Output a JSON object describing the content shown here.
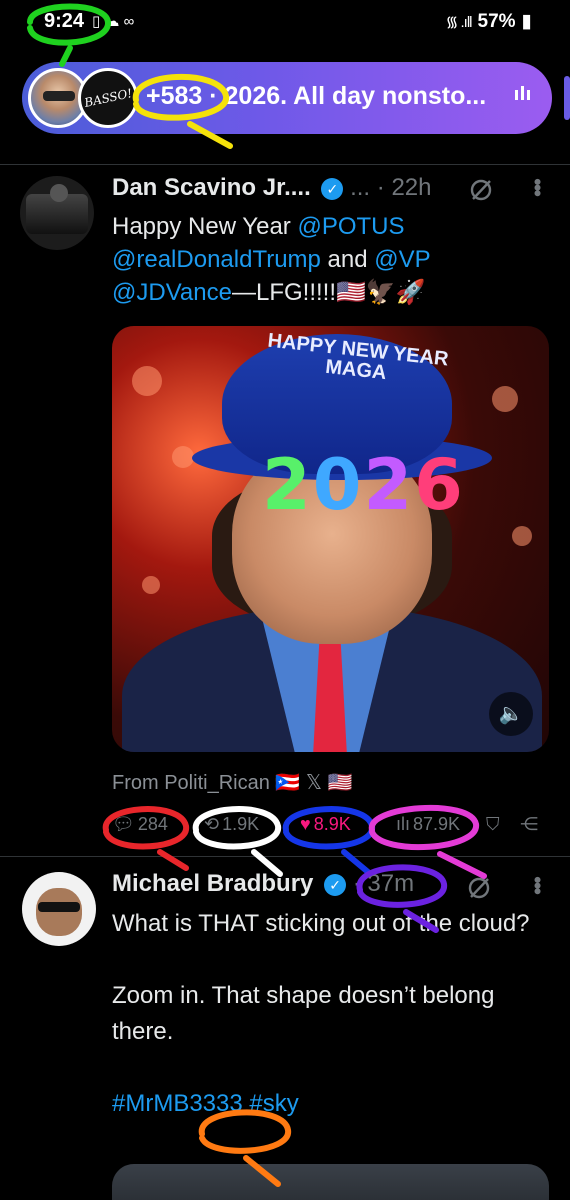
{
  "status_bar": {
    "time": "9:24",
    "left_icons": "▯ ☁ ∞",
    "battery": "57%",
    "signal_icon": "wifi-signal-icon"
  },
  "live_space": {
    "pill_text": "+583 · 2026. All day nonsto...",
    "avatar2_text": "BASSO!"
  },
  "tweet1": {
    "name": "Dan Scavino Jr....",
    "meta_dots": "...",
    "time": "· 22h",
    "body": {
      "text1": "Happy New Year ",
      "mention1": "@POTUS",
      "mention2": "@realDonaldTrump",
      "text2": " and ",
      "mention3": "@VP",
      "mention4": "@JDVance",
      "text3": "—LFG!!!!!🇺🇸🦅🚀"
    },
    "media": {
      "hat_text": "HAPPY NEW YEAR MAGA",
      "glasses_digits": [
        "2",
        "0",
        "2",
        "6"
      ]
    },
    "from": "From Politi_Rican 🇵🇷 𝕏 🇺🇸",
    "actions": {
      "replies": "284",
      "reposts": "1.9K",
      "likes": "8.9K",
      "views": "87.9K"
    }
  },
  "tweet2": {
    "name": "Michael Bradbury",
    "time": "· 37m",
    "body": {
      "line1": "What is THAT sticking out of the cloud?",
      "line2": "Zoom in. That shape doesn’t belong there.",
      "hashtags": "#MrMB3333 #sky"
    }
  },
  "colors": {
    "accent_blue": "#1d9bf0",
    "like_pink": "#f91880",
    "pill_gradient_start": "#4b5dd8",
    "pill_gradient_end": "#9b5cf0"
  }
}
